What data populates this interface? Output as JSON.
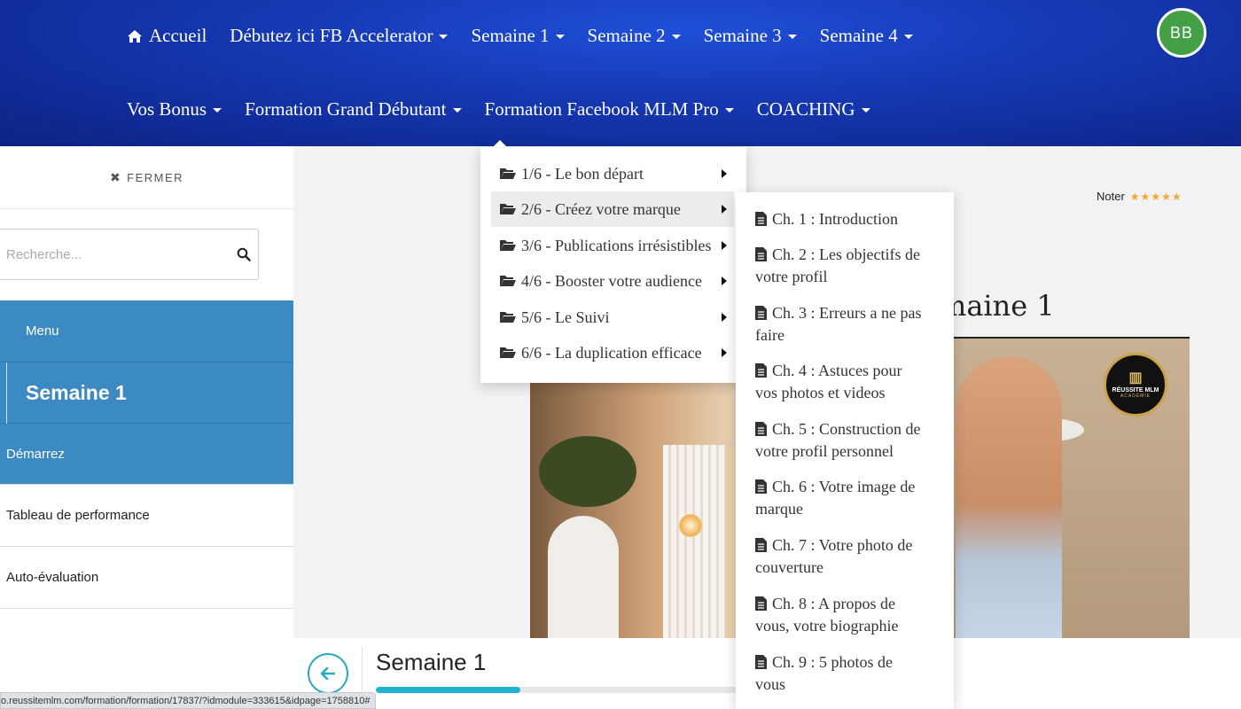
{
  "nav": {
    "row1": [
      {
        "label": "Accueil",
        "icon": "home-icon",
        "caret": false
      },
      {
        "label": "Débutez ici FB Accelerator",
        "caret": true
      },
      {
        "label": "Semaine 1",
        "caret": true
      },
      {
        "label": "Semaine 2",
        "caret": true
      },
      {
        "label": "Semaine 3",
        "caret": true
      },
      {
        "label": "Semaine 4",
        "caret": true
      }
    ],
    "row2": [
      {
        "label": "Vos Bonus",
        "caret": true
      },
      {
        "label": "Formation Grand Débutant",
        "caret": true
      },
      {
        "label": "Formation Facebook MLM Pro",
        "caret": true
      },
      {
        "label": "COACHING",
        "caret": true
      }
    ],
    "avatar_initials": "BB",
    "avatar_color": "#43a047"
  },
  "sidebar": {
    "close_label": "FERMER",
    "search_placeholder": "Recherche...",
    "menu_label": "Menu",
    "week_label": "Semaine 1",
    "items": [
      "Démarrez",
      "Tableau de performance",
      "Auto-évaluation"
    ],
    "accent": "#3b8ac2"
  },
  "main": {
    "rating_label": "Noter",
    "stars": "★★★★★",
    "heading_visible": "maine 1",
    "video_logo": {
      "line1": "RÉUSSITE MLM",
      "line2": "ACADÉMIE"
    },
    "bottom_title": "Semaine 1",
    "progress_percent": 34,
    "progress_color": "#20b3cf"
  },
  "dropdown": {
    "items": [
      "1/6 - Le bon départ",
      "2/6 - Créez votre marque",
      "3/6 - Publications irrésistibles",
      "4/6 - Booster votre audience",
      "5/6 - Le Suivi",
      "6/6 - La duplication efficace"
    ],
    "active_index": 1
  },
  "submenu": {
    "items": [
      [
        "Ch. 1 : Introduction"
      ],
      [
        "Ch. 2 : Les objectifs de",
        "votre profil"
      ],
      [
        "Ch. 3 : Erreurs a ne pas",
        "faire"
      ],
      [
        "Ch. 4 : Astuces pour",
        "vos photos et videos"
      ],
      [
        "Ch. 5 : Construction de",
        "votre profil personnel"
      ],
      [
        "Ch. 6 : Votre image de",
        "marque"
      ],
      [
        "Ch. 7 : Votre photo de",
        "couverture"
      ],
      [
        "Ch. 8 : A propos de",
        "vous, votre biographie"
      ],
      [
        "Ch. 9 : 5 photos de",
        "vous"
      ]
    ]
  },
  "status_url": "o.reussitemlm.com/formation/formation/17837/?idmodule=333615&idpage=1758810#"
}
